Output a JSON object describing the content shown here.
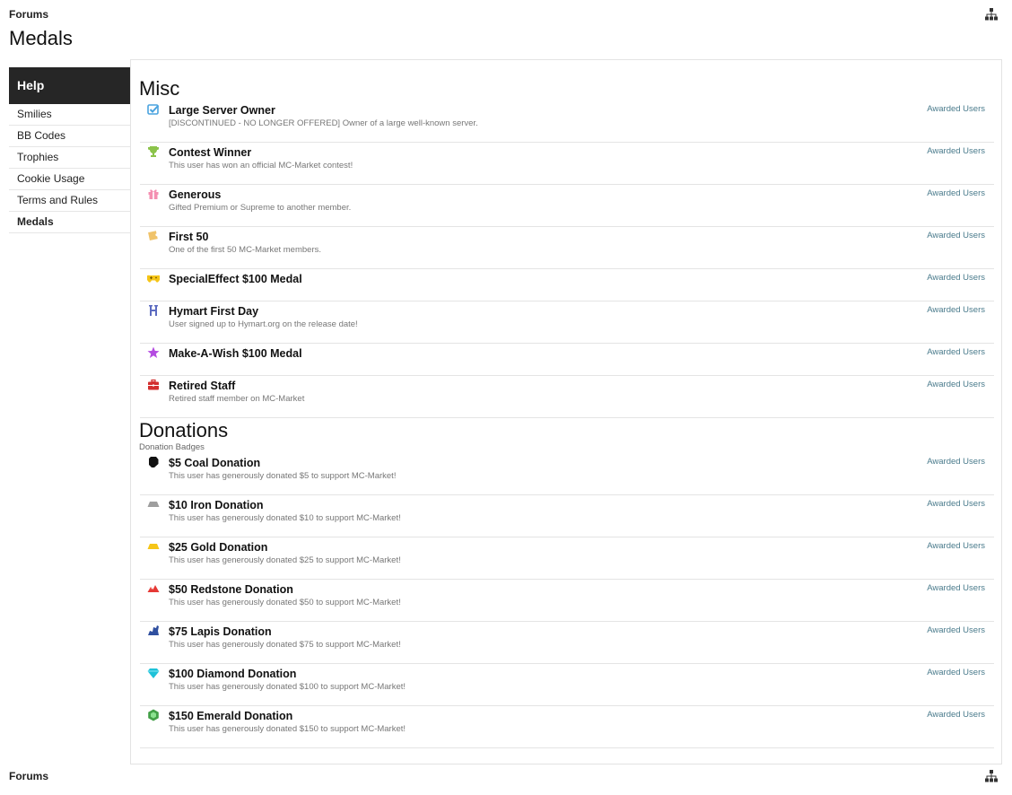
{
  "breadcrumb": {
    "label": "Forums"
  },
  "page": {
    "title": "Medals"
  },
  "sidebar": {
    "heading": "Help",
    "items": [
      {
        "label": "Smilies",
        "active": false
      },
      {
        "label": "BB Codes",
        "active": false
      },
      {
        "label": "Trophies",
        "active": false
      },
      {
        "label": "Cookie Usage",
        "active": false
      },
      {
        "label": "Terms and Rules",
        "active": false
      },
      {
        "label": "Medals",
        "active": true
      }
    ]
  },
  "misc": {
    "title": "Misc",
    "medals": [
      {
        "name": "Large Server Owner",
        "desc": "[DISCONTINUED - NO LONGER OFFERED] Owner of a large well-known server.",
        "icon": "checkmark-icon",
        "color": "#4aa3df",
        "link": "Awarded Users"
      },
      {
        "name": "Contest Winner",
        "desc": "This user has won an official MC-Market contest!",
        "icon": "trophy-icon",
        "color": "#8bc34a",
        "link": "Awarded Users"
      },
      {
        "name": "Generous",
        "desc": "Gifted Premium or Supreme to another member.",
        "icon": "gift-icon",
        "color": "#f48fb1",
        "link": "Awarded Users"
      },
      {
        "name": "First 50",
        "desc": "One of the first 50 MC-Market members.",
        "icon": "ticket-icon",
        "color": "#f0c36a",
        "link": "Awarded Users"
      },
      {
        "name": "SpecialEffect $100 Medal",
        "desc": "",
        "icon": "gamepad-icon",
        "color": "#f5c518",
        "link": "Awarded Users"
      },
      {
        "name": "Hymart First Day",
        "desc": "User signed up to Hymart.org on the release date!",
        "icon": "hymart-icon",
        "color": "#5c6bc0",
        "link": "Awarded Users"
      },
      {
        "name": "Make-A-Wish $100 Medal",
        "desc": "",
        "icon": "star-icon",
        "color": "#b44be1",
        "link": "Awarded Users"
      },
      {
        "name": "Retired Staff",
        "desc": "Retired staff member on MC-Market",
        "icon": "briefcase-icon",
        "color": "#d32f2f",
        "link": "Awarded Users"
      }
    ]
  },
  "donations": {
    "title": "Donations",
    "subtitle": "Donation Badges",
    "medals": [
      {
        "name": "$5 Coal Donation",
        "desc": "This user has generously donated $5 to support MC-Market!",
        "icon": "coal-icon",
        "color": "#111111",
        "link": "Awarded Users"
      },
      {
        "name": "$10 Iron Donation",
        "desc": "This user has generously donated $10 to support MC-Market!",
        "icon": "iron-ingot-icon",
        "color": "#9e9e9e",
        "link": "Awarded Users"
      },
      {
        "name": "$25 Gold Donation",
        "desc": "This user has generously donated $25 to support MC-Market!",
        "icon": "gold-ingot-icon",
        "color": "#f5c518",
        "link": "Awarded Users"
      },
      {
        "name": "$50 Redstone Donation",
        "desc": "This user has generously donated $50 to support MC-Market!",
        "icon": "redstone-icon",
        "color": "#e53935",
        "link": "Awarded Users"
      },
      {
        "name": "$75 Lapis Donation",
        "desc": "This user has generously donated $75 to support MC-Market!",
        "icon": "lapis-icon",
        "color": "#2f4f9f",
        "link": "Awarded Users"
      },
      {
        "name": "$100 Diamond Donation",
        "desc": "This user has generously donated $100 to support MC-Market!",
        "icon": "diamond-icon",
        "color": "#1ec2d8",
        "link": "Awarded Users"
      },
      {
        "name": "$150 Emerald Donation",
        "desc": "This user has generously donated $150 to support MC-Market!",
        "icon": "emerald-icon",
        "color": "#43a047",
        "link": "Awarded Users"
      }
    ]
  },
  "footer": {
    "breadcrumb": "Forums"
  }
}
